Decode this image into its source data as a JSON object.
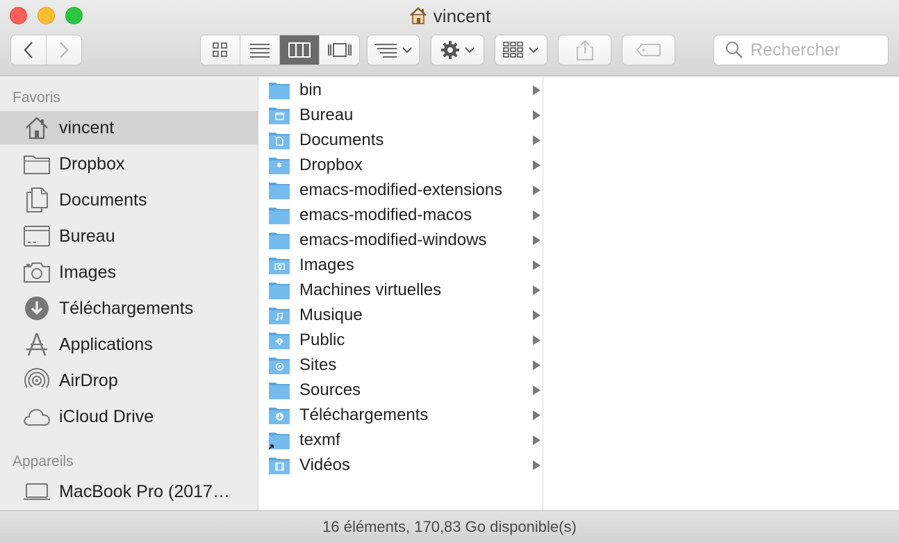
{
  "window": {
    "title": "vincent"
  },
  "toolbar": {
    "search_placeholder": "Rechercher",
    "view_modes": [
      "icon-view",
      "list-view",
      "column-view",
      "gallery-view"
    ],
    "active_view": "column-view"
  },
  "sidebar": {
    "favorites_heading": "Favoris",
    "favorites": [
      {
        "label": "vincent",
        "icon": "home-icon",
        "selected": true
      },
      {
        "label": "Dropbox",
        "icon": "folder-icon"
      },
      {
        "label": "Documents",
        "icon": "documents-icon"
      },
      {
        "label": "Bureau",
        "icon": "desktop-icon"
      },
      {
        "label": "Images",
        "icon": "camera-icon"
      },
      {
        "label": "Téléchargements",
        "icon": "download-icon"
      },
      {
        "label": "Applications",
        "icon": "applications-icon"
      },
      {
        "label": "AirDrop",
        "icon": "airdrop-icon"
      },
      {
        "label": "iCloud Drive",
        "icon": "cloud-icon"
      }
    ],
    "devices_heading": "Appareils",
    "devices": [
      {
        "label": "MacBook Pro (2017…",
        "icon": "laptop-icon"
      }
    ]
  },
  "column": {
    "items": [
      {
        "name": "bin",
        "badge": "none"
      },
      {
        "name": "Bureau",
        "badge": "desktop"
      },
      {
        "name": "Documents",
        "badge": "document"
      },
      {
        "name": "Dropbox",
        "badge": "dropbox"
      },
      {
        "name": "emacs-modified-extensions",
        "badge": "none"
      },
      {
        "name": "emacs-modified-macos",
        "badge": "none"
      },
      {
        "name": "emacs-modified-windows",
        "badge": "none"
      },
      {
        "name": "Images",
        "badge": "camera"
      },
      {
        "name": "Machines virtuelles",
        "badge": "none"
      },
      {
        "name": "Musique",
        "badge": "music"
      },
      {
        "name": "Public",
        "badge": "public"
      },
      {
        "name": "Sites",
        "badge": "compass"
      },
      {
        "name": "Sources",
        "badge": "none"
      },
      {
        "name": "Téléchargements",
        "badge": "download"
      },
      {
        "name": "texmf",
        "badge": "alias"
      },
      {
        "name": "Vidéos",
        "badge": "film"
      }
    ]
  },
  "status": {
    "text": "16 éléments, 170,83 Go disponible(s)"
  },
  "colors": {
    "folder": "#74bcf0",
    "folder_dark": "#5aa6e0",
    "sidebar_bg": "#ececec",
    "selection": "#d3d3d3"
  }
}
